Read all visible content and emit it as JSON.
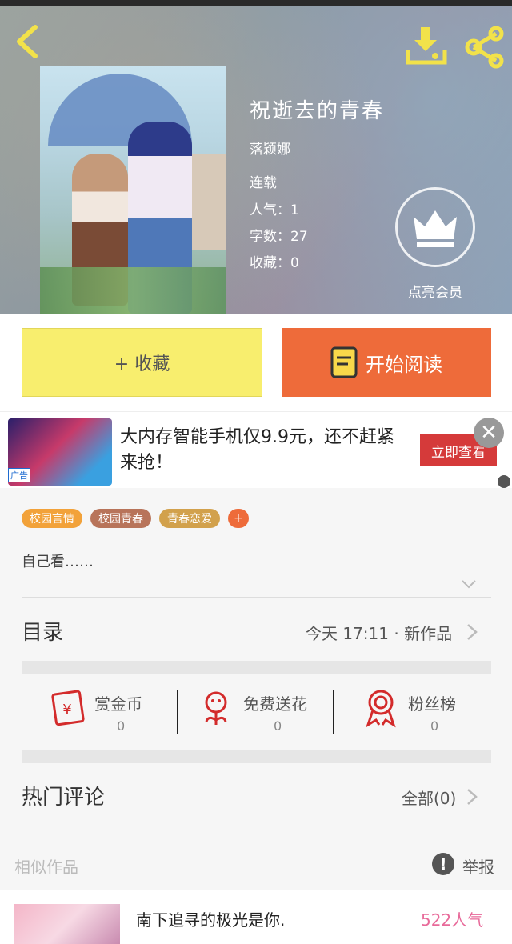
{
  "book": {
    "title": "祝逝去的青春",
    "author": "落颖娜",
    "status": "连载",
    "popularity": "人气：1",
    "word_count": "字数：27",
    "favorites": "收藏：0",
    "vip_label": "点亮会员"
  },
  "icons": {
    "back": "back-arrow-icon",
    "download": "download-icon",
    "share": "share-icon",
    "vip": "crown-icon",
    "read": "book-icon",
    "reward": "red-envelope-icon",
    "flower": "flower-icon",
    "fans": "ribbon-medal-icon",
    "report": "exclamation-icon"
  },
  "actions": {
    "favorite_label": "+ 收藏",
    "read_label": "开始阅读"
  },
  "ad": {
    "badge": "广告",
    "text": "大内存智能手机仅9.9元，还不赶紧来抢！",
    "cta": "立即查看",
    "close": "✕"
  },
  "tags": [
    "校园言情",
    "校园青春",
    "青春恋爱",
    "+"
  ],
  "description": "自己看……",
  "toc": {
    "label": "目录",
    "latest": "今天 17:11 · 新作品"
  },
  "stats": [
    {
      "label": "赏金币",
      "value": "0"
    },
    {
      "label": "免费送花",
      "value": "0"
    },
    {
      "label": "粉丝榜",
      "value": "0"
    }
  ],
  "comments": {
    "label": "热门评论",
    "all": "全部(0)"
  },
  "similar": {
    "label": "相似作品",
    "report": "举报",
    "items": [
      {
        "title": "南下追寻的极光是你.",
        "popularity": "522人气"
      }
    ]
  },
  "colors": {
    "favorite_bg": "#f8ee6e",
    "read_bg": "#ee6b3a",
    "ad_cta": "#d53a3a",
    "tag_orange": "#f2a23a",
    "tag_brown": "#b8745a",
    "tag_gold": "#d2a14c",
    "stat_icon_red": "#d32b2b",
    "popularity_pink": "#e86a9a"
  }
}
